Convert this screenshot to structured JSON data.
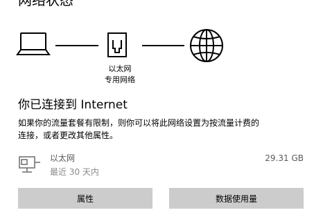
{
  "page": {
    "title": "网络状态"
  },
  "diagram": {
    "computer_icon": "laptop-icon",
    "ethernet_icon": "ethernet-port-icon",
    "internet_icon": "globe-icon",
    "ethernet_label": "以太网",
    "network_label": "专用网络"
  },
  "status": {
    "heading": "你已连接到 Internet",
    "desc_line1": "如果你的流量套餐有限制，则你可以将此网络设置为按流量计费的",
    "desc_line2": "连接，或者更改其他属性。"
  },
  "adapter": {
    "icon": "ethernet-adapter-icon",
    "name": "以太网",
    "time": "最近 30 天内",
    "usage": "29.31 GB"
  },
  "buttons": {
    "properties": "属性",
    "data_usage": "数据使用量"
  },
  "colors": {
    "button_bg": "#cccccc",
    "secondary_text": "#5a5a5a",
    "tertiary_text": "#8a8a8a"
  }
}
